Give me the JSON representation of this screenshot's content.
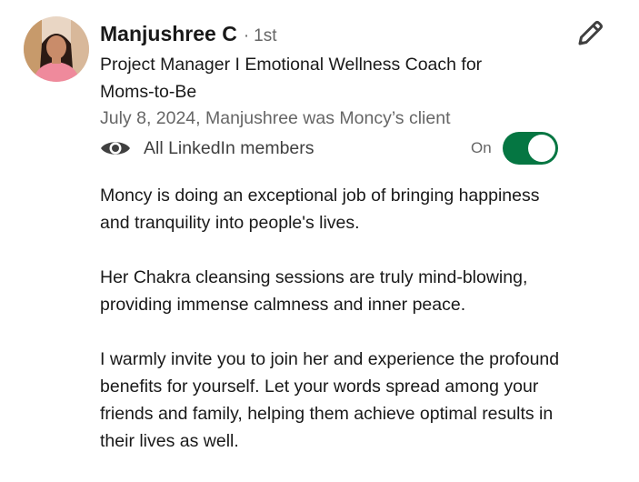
{
  "recommender": {
    "name": "Manjushree C",
    "separator": "·",
    "degree": "1st",
    "headline": "Project Manager I Emotional Wellness Coach for Moms-to-Be",
    "relation": "July 8, 2024, Manjushree was Moncy’s client",
    "avatar_icon": "profile-photo"
  },
  "visibility": {
    "icon": "eye-icon",
    "label": "All LinkedIn members",
    "toggle_label": "On",
    "toggle_on": true,
    "accent_color": "#057642"
  },
  "actions": {
    "edit_icon": "pencil-icon"
  },
  "recommendation": {
    "paragraphs": [
      "Moncy is doing an exceptional job of bringing happiness and tranquility into people's lives.",
      "Her Chakra cleansing sessions are truly mind-blowing, providing immense calmness and inner peace.",
      "I warmly invite you to join her and experience the profound benefits for yourself. Let your words spread among your friends and family, helping them achieve optimal results in their lives as well."
    ]
  }
}
